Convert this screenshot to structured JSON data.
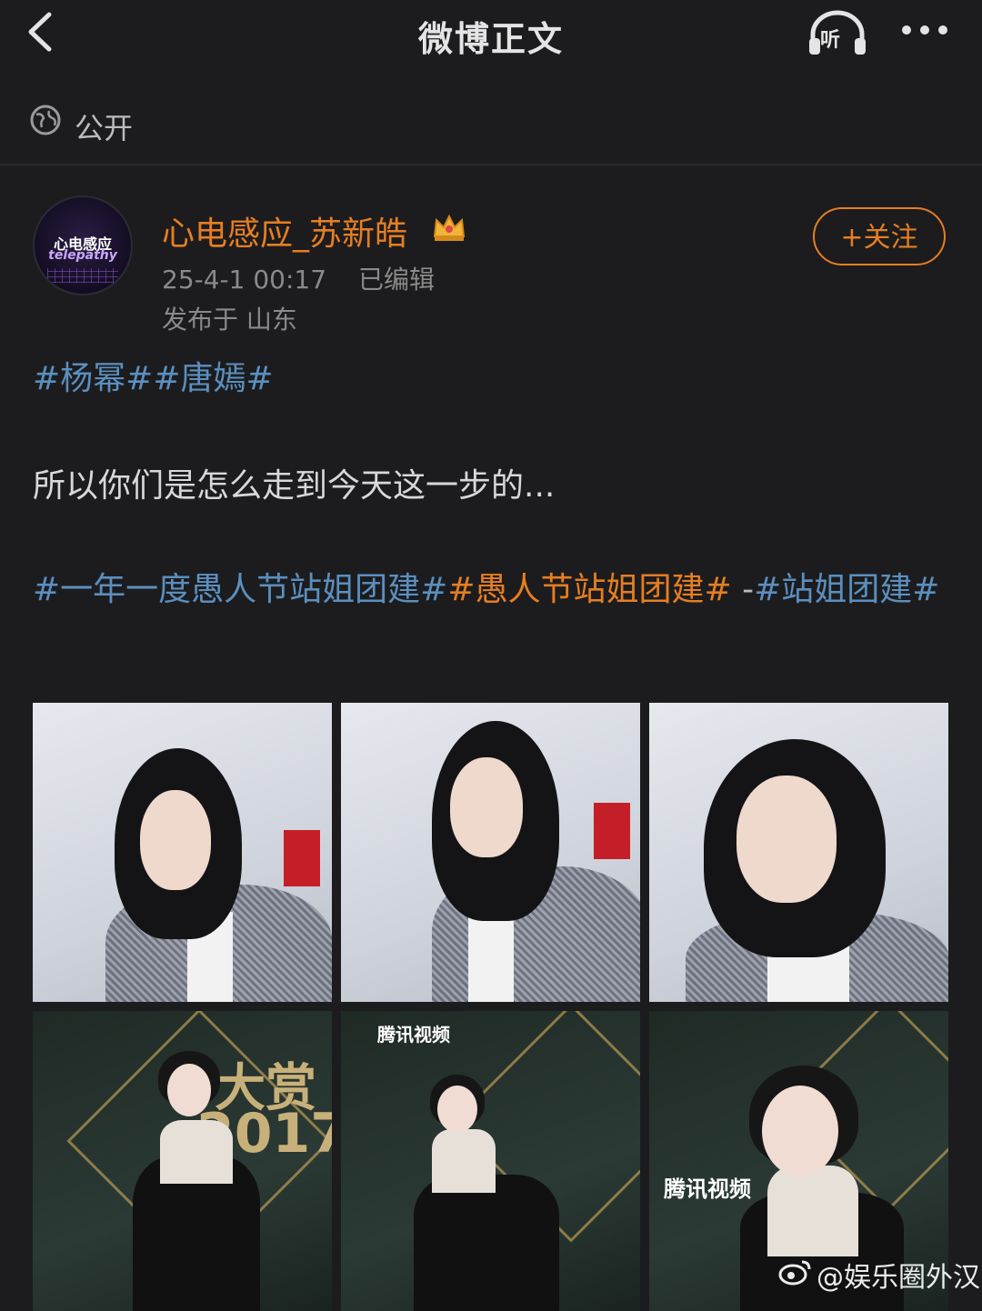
{
  "header": {
    "title": "微博正文",
    "listen_label": "听"
  },
  "visibility": {
    "label": "公开"
  },
  "post": {
    "author": "心电感应_苏新皓",
    "avatar_text_top": "心电感应",
    "avatar_text_bottom": "telepathy",
    "timestamp": "25-4-1 00:17",
    "edited": "已编辑",
    "location": "发布于 山东",
    "follow_label": "+关注",
    "hashtags_top": "#杨幂##唐嫣#",
    "body": "所以你们是怎么走到今天这一步的...",
    "tags2": {
      "tag1": "#一年一度愚人节站姐团建#",
      "tag2": "#愚人节站姐团建#",
      "sep": " -",
      "tag3": "#站姐团建#"
    }
  },
  "images": {
    "photo5_text": "腾讯视频",
    "photo6_text": "腾讯视频",
    "photo4_text": "2017",
    "photo4_big": "大赏"
  },
  "watermark": {
    "text": "@娱乐圈外汉"
  },
  "colors": {
    "accent": "#e67e22",
    "link": "#5b8fbf",
    "background": "#1c1c1e"
  }
}
